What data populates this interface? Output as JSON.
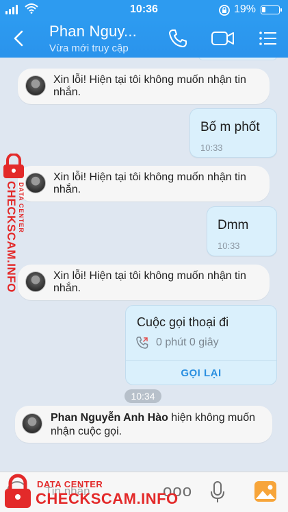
{
  "status_bar": {
    "time": "10:36",
    "battery_percent": "19%",
    "icons": [
      "signal-icon",
      "wifi-icon",
      "rotation-lock-icon",
      "battery-icon"
    ]
  },
  "header": {
    "contact_name": "Phan Nguy...",
    "status": "Vừa mới truy cập",
    "icons": [
      "back-icon",
      "voice-call-icon",
      "video-call-icon",
      "menu-icon"
    ],
    "accent_color": "#2d9bf0"
  },
  "messages": [
    {
      "type": "system",
      "text": "Xin lỗi! Hiện tại tôi không muốn nhận tin nhắn."
    },
    {
      "type": "outgoing",
      "text": "Bố m phốt",
      "time": "10:33"
    },
    {
      "type": "system",
      "text": "Xin lỗi! Hiện tại tôi không muốn nhận tin nhắn."
    },
    {
      "type": "outgoing",
      "text": "Dmm",
      "time": "10:33"
    },
    {
      "type": "system",
      "text": "Xin lỗi! Hiện tại tôi không muốn nhận tin nhắn."
    }
  ],
  "call_card": {
    "title": "Cuộc gọi thoại đi",
    "duration": "0 phút 0 giây",
    "action": "GỌI LẠI"
  },
  "time_divider": "10:34",
  "call_notice": {
    "name": "Phan Nguyễn Anh Hào",
    "text": " hiện không muốn nhận cuộc gọi."
  },
  "input_bar": {
    "placeholder": "Tin nhắn",
    "more": "ooo",
    "icons": [
      "emoji-icon",
      "more-icon",
      "microphone-icon",
      "image-icon"
    ]
  },
  "watermark": {
    "line1": "DATA CENTER",
    "line2": "CHECKSCAM.INFO",
    "color": "#e32a2a"
  }
}
